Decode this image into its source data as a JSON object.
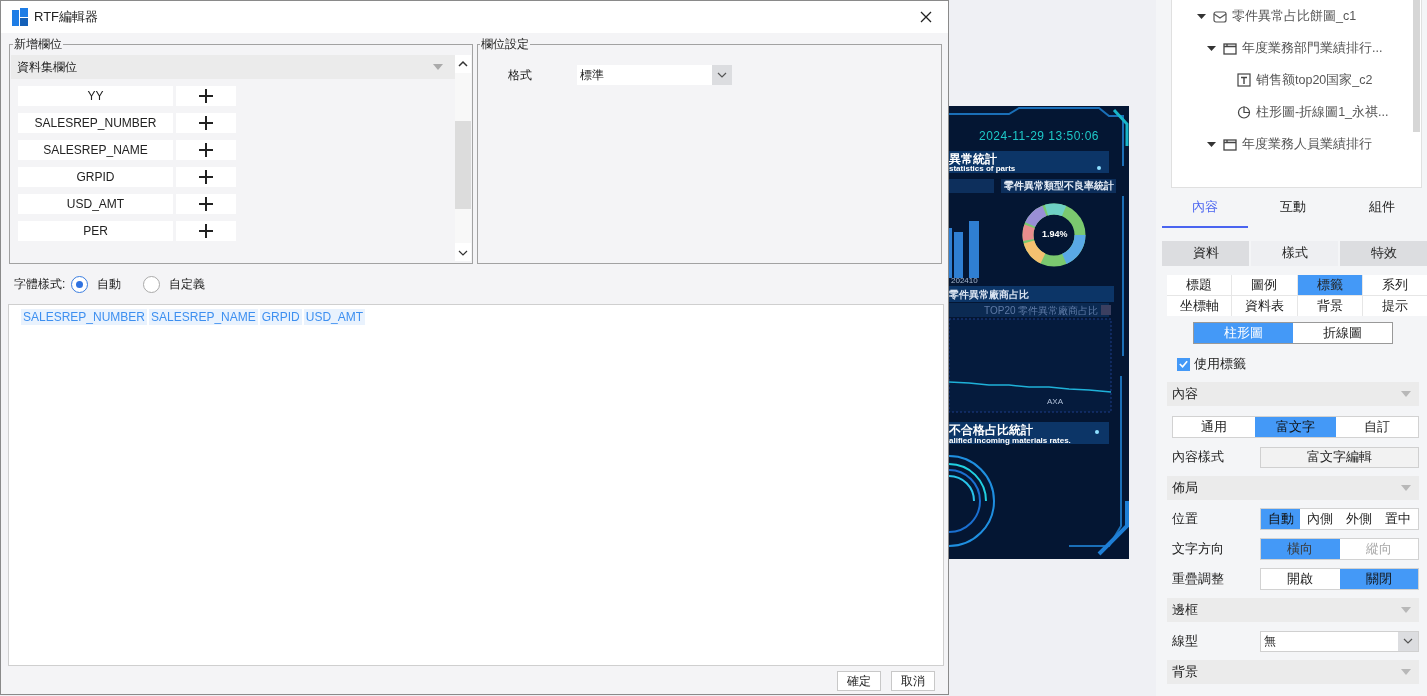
{
  "dialog": {
    "title": "RTF編輯器",
    "field_panel": {
      "legend": "新增欄位",
      "dataset": "資料集欄位",
      "fields": [
        {
          "name": "YY"
        },
        {
          "name": "SALESREP_NUMBER"
        },
        {
          "name": "SALESREP_NAME"
        },
        {
          "name": "GRPID"
        },
        {
          "name": "USD_AMT"
        },
        {
          "name": "PER"
        }
      ]
    },
    "settings_panel": {
      "legend": "欄位設定",
      "format_label": "格式",
      "format_value": "標準"
    },
    "font_style": {
      "label": "字體樣式:",
      "options": [
        {
          "label": "自動",
          "selected": true
        },
        {
          "label": "自定義",
          "selected": false
        }
      ]
    },
    "editor": {
      "tokens": [
        "SALESREP_NUMBER",
        "SALESREP_NAME",
        "GRPID",
        "USD_AMT"
      ]
    },
    "buttons": [
      "確定",
      "取消"
    ]
  },
  "preview": {
    "timestamp": "2024-11-29 13:50:06",
    "texts": [
      {
        "kind": "title",
        "text": "異常統計"
      },
      {
        "kind": "subtitle",
        "text": "statistics of parts"
      },
      {
        "kind": "chart_title",
        "text": "零件異常類型不良率統計"
      },
      {
        "kind": "center",
        "text": "1.94%"
      },
      {
        "kind": "axis",
        "text": "202410"
      },
      {
        "kind": "section",
        "text": "零件異常廠商占比"
      },
      {
        "kind": "tab",
        "text": "TOP20 零件異常廠商占比"
      },
      {
        "kind": "axis2",
        "text": "AXA"
      },
      {
        "kind": "title2",
        "text": "不合格占比統計"
      },
      {
        "kind": "subtitle2",
        "text": "alified incoming materials rates."
      }
    ]
  },
  "panel": {
    "tree": [
      {
        "label": "零件異常占比餅圖_c1",
        "kind": "envelope",
        "expanded": true,
        "children": [
          {
            "label": "年度業務部門業績排行...",
            "kind": "folder",
            "expanded": true,
            "children": [
              {
                "label": "销售额top20国家_c2",
                "kind": "text"
              },
              {
                "label": "柱形圖-折線圖1_永祺...",
                "kind": "pie"
              }
            ]
          },
          {
            "label": "年度業務人員業績排行",
            "kind": "folder",
            "expanded": true
          }
        ]
      }
    ],
    "tabs": [
      {
        "label": "內容",
        "selected": true
      },
      {
        "label": "互動",
        "selected": false
      },
      {
        "label": "組件",
        "selected": false
      }
    ],
    "sub_tabs": [
      {
        "label": "資料",
        "selected": false
      },
      {
        "label": "樣式",
        "selected": true
      },
      {
        "label": "特效",
        "selected": false
      }
    ],
    "style_tabs": [
      {
        "label": "標題",
        "selected": false
      },
      {
        "label": "圖例",
        "selected": false
      },
      {
        "label": "標籤",
        "selected": true
      },
      {
        "label": "系列",
        "selected": false
      },
      {
        "label": "坐標軸",
        "selected": false
      },
      {
        "label": "資料表",
        "selected": false
      },
      {
        "label": "背景",
        "selected": false
      },
      {
        "label": "提示",
        "selected": false
      }
    ],
    "chart_types": [
      {
        "label": "柱形圖",
        "selected": true
      },
      {
        "label": "折線圖",
        "selected": false
      }
    ],
    "use_label": {
      "label": "使用標籤",
      "checked": true
    },
    "rows": [
      {
        "kind": "header",
        "label": "內容"
      },
      {
        "kind": "segmented",
        "options": [
          {
            "label": "通用",
            "selected": false
          },
          {
            "label": "富文字",
            "selected": true
          },
          {
            "label": "自訂",
            "selected": false
          }
        ]
      },
      {
        "kind": "button",
        "label": "內容樣式",
        "button": "富文字編輯"
      },
      {
        "kind": "header",
        "label": "佈局"
      },
      {
        "kind": "segmented",
        "label": "位置",
        "options": [
          {
            "label": "自動",
            "selected": true
          },
          {
            "label": "內側",
            "selected": false
          },
          {
            "label": "外側",
            "selected": false
          },
          {
            "label": "置中",
            "selected": false
          }
        ]
      },
      {
        "kind": "segmented",
        "label": "文字方向",
        "disabled": true,
        "options": [
          {
            "label": "橫向",
            "selected": true
          },
          {
            "label": "縱向",
            "selected": false
          }
        ]
      },
      {
        "kind": "segmented",
        "label": "重疊調整",
        "options": [
          {
            "label": "開啟",
            "selected": false
          },
          {
            "label": "關閉",
            "selected": true
          }
        ]
      },
      {
        "kind": "header",
        "label": "邊框"
      },
      {
        "kind": "select",
        "label": "線型",
        "value": "無"
      },
      {
        "kind": "header",
        "label": "背景"
      }
    ]
  }
}
